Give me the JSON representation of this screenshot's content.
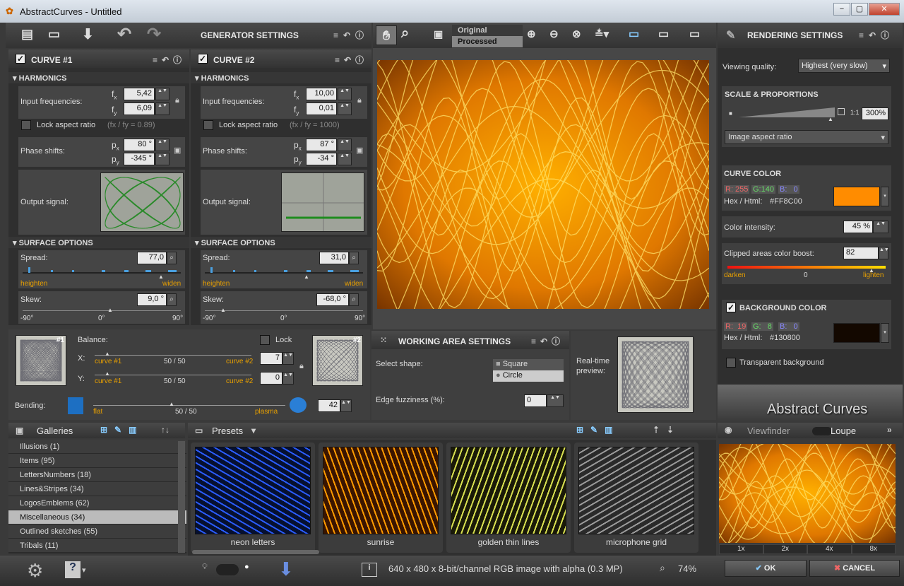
{
  "window": {
    "title": "AbstractCurves - Untitled",
    "min": "−",
    "max": "▢",
    "close": "✕"
  },
  "generator": {
    "title": "GENERATOR SETTINGS"
  },
  "curve1": {
    "title": "CURVE #1",
    "harmonics": "HARMONICS",
    "input_freq_label": "Input frequencies:",
    "fx_label": "f",
    "fx_sub": "x",
    "fy_sub": "y",
    "fx": "5,42",
    "fy": "6,09",
    "lock_label": "Lock aspect ratio",
    "lock_hint": "(f",
    "lock_hint_full": "(fx / fy = 0.89)",
    "phase_label": "Phase shifts:",
    "px_sub": "x",
    "py_sub": "y",
    "p_label": "p",
    "px": "80 °",
    "py": "-345 °",
    "output_label": "Output signal:",
    "surface": "SURFACE OPTIONS",
    "spread_label": "Spread:",
    "spread": "77,0",
    "heighten": "heighten",
    "widen": "widen",
    "skew_label": "Skew:",
    "skew": "9,0 °",
    "skew_min": "-90°",
    "skew_mid": "0°",
    "skew_max": "90°"
  },
  "curve2": {
    "title": "CURVE #2",
    "harmonics": "HARMONICS",
    "input_freq_label": "Input frequencies:",
    "fx": "10,00",
    "fy": "0,01",
    "lock_label": "Lock aspect ratio",
    "lock_hint_full": "(fx / fy = 1000)",
    "phase_label": "Phase shifts:",
    "px": "87 °",
    "py": "-34 °",
    "output_label": "Output signal:",
    "surface": "SURFACE OPTIONS",
    "spread_label": "Spread:",
    "spread": "31,0",
    "heighten": "heighten",
    "widen": "widen",
    "skew_label": "Skew:",
    "skew": "-68,0 °",
    "skew_min": "-90°",
    "skew_mid": "0°",
    "skew_max": "90°"
  },
  "balance": {
    "label": "Balance:",
    "lock": "Lock",
    "x_label": "X:",
    "y_label": "Y:",
    "left": "curve #1",
    "mid": "50 / 50",
    "right": "curve #2",
    "x_value": "7",
    "y_value": "0",
    "badge1": "#1",
    "badge2": "#2",
    "bending": "Bending:",
    "flat": "flat",
    "plasma": "plasma",
    "bend_mid": "50 / 50",
    "bend_value": "42"
  },
  "toolbar": {
    "original": "Original",
    "processed": "Processed"
  },
  "working": {
    "title": "WORKING AREA SETTINGS",
    "shape_label": "Select shape:",
    "square": "Square",
    "circle": "Circle",
    "fuzz_label": "Edge fuzziness (%):",
    "fuzz": "0",
    "preview_label": "Real-time preview:"
  },
  "rendering": {
    "title": "RENDERING SETTINGS",
    "quality_label": "Viewing quality:",
    "quality": "Highest (very slow)",
    "scale_title": "SCALE & PROPORTIONS",
    "ratio_label": "1:1",
    "zoom": "300%",
    "aspect": "Image aspect ratio",
    "color_title": "CURVE COLOR",
    "r": "R: 255",
    "g": "G:140",
    "b": "B:   0",
    "hex_label": "Hex / Html:",
    "hex": "#FF8C00",
    "curve_color": "#FF8C00",
    "intensity_label": "Color intensity:",
    "intensity": "45 %",
    "boost_label": "Clipped areas color boost:",
    "boost": "82",
    "darken": "darken",
    "zero": "0",
    "lighten": "lighten",
    "bg_title": "BACKGROUND COLOR",
    "bg_r": "R:  19",
    "bg_g": "G:   8",
    "bg_b": "B:   0",
    "bg_hex_label": "Hex / Html:",
    "bg_hex": "#130800",
    "bg_color": "#130800",
    "transparent": "Transparent background"
  },
  "logo": {
    "text": "Abstract Curves"
  },
  "galleries": {
    "title": "Galleries",
    "items": [
      "Illusions (1)",
      "Items (95)",
      "LettersNumbers (18)",
      "Lines&Stripes (34)",
      "LogosEmblems (62)",
      "Miscellaneous (34)",
      "Outlined sketches (55)",
      "Tribals (11)"
    ],
    "selected": 5
  },
  "presets": {
    "title": "Presets",
    "items": [
      "neon letters",
      "sunrise",
      "golden thin lines",
      "microphone grid"
    ]
  },
  "viewfinder": {
    "title": "Viewfinder",
    "loupe": "Loupe",
    "zooms": [
      "1x",
      "2x",
      "4x",
      "8x"
    ]
  },
  "status": {
    "info": "640 x 480 x 8-bit/channel RGB image with alpha (0.3 MP)",
    "zoom": "74%"
  },
  "buttons": {
    "ok": "OK",
    "cancel": "CANCEL"
  }
}
